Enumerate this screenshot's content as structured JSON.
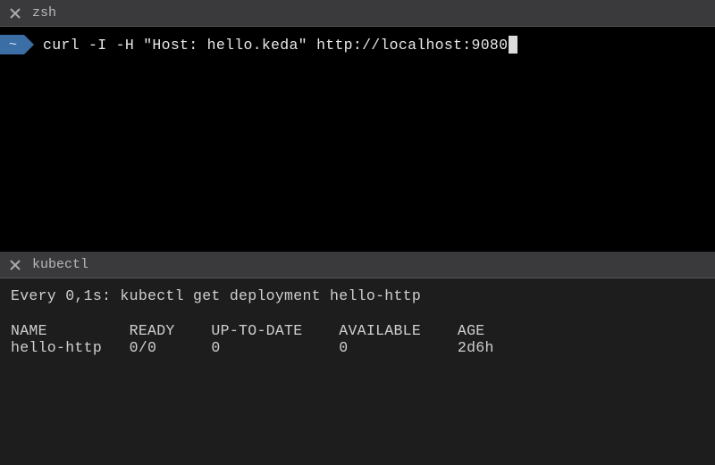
{
  "pane_top": {
    "title": "zsh",
    "prompt_dir": "~",
    "command": "curl -I -H \"Host: hello.keda\" http://localhost:9080"
  },
  "pane_bottom": {
    "title": "kubectl",
    "watch_line": "Every 0,1s: kubectl get deployment hello-http",
    "table": {
      "headers": [
        "NAME",
        "READY",
        "UP-TO-DATE",
        "AVAILABLE",
        "AGE"
      ],
      "rows": [
        {
          "name": "hello-http",
          "ready": "0/0",
          "up_to_date": "0",
          "available": "0",
          "age": "2d6h"
        }
      ]
    }
  }
}
